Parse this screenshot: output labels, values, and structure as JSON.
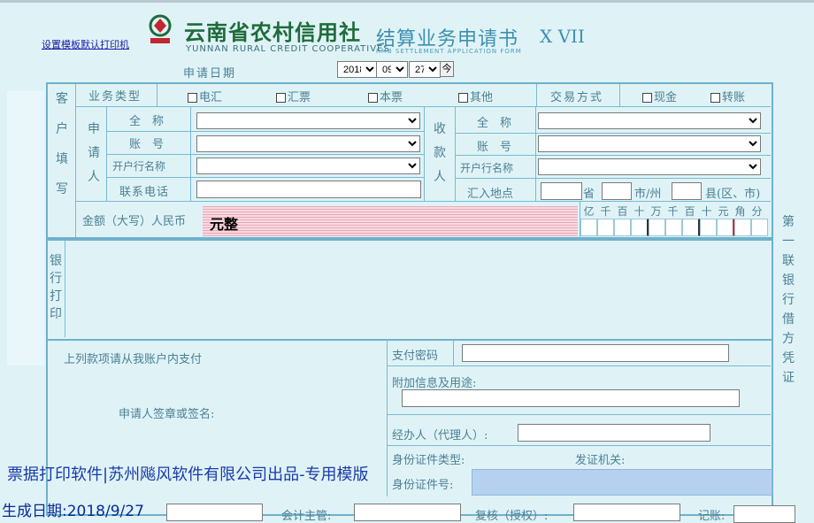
{
  "header": {
    "template_link": "设置模板默认打印机",
    "bank_name_cn": "云南省农村信用社",
    "bank_name_en": "YUNNAN RURAL CREDIT COOPERATIVES",
    "form_title": "结算业务申请书",
    "form_title_en": "RMB SETTLEMENT APPLICATION FORM",
    "form_code": "X VII",
    "apply_date_label": "申请日期",
    "date": {
      "year": "2018",
      "month": "09",
      "day": "27",
      "today_btn": "今"
    }
  },
  "section_labels": {
    "customer_fill": [
      "客",
      "户",
      "填",
      "写"
    ],
    "bank_print": [
      "银",
      "行",
      "打",
      "印"
    ],
    "applicant": [
      "申",
      "请",
      "人"
    ],
    "payee": [
      "收",
      "款",
      "人"
    ]
  },
  "business": {
    "type_label": "业务类型",
    "options": [
      "电汇",
      "汇票",
      "本票",
      "其他"
    ],
    "method_label": "交易方式",
    "methods": [
      "现金",
      "转账"
    ]
  },
  "fields": {
    "name": "全　称",
    "account": "账　号",
    "bank": "开户行名称",
    "phone": "联系电话",
    "remit_place": "汇入地点",
    "province": "省",
    "city": "市/州",
    "county": "县(区、市)"
  },
  "amount": {
    "label": "金额（大写）人民币",
    "value": "元整",
    "digits": [
      "亿",
      "千",
      "百",
      "十",
      "万",
      "千",
      "百",
      "十",
      "元",
      "角",
      "分"
    ]
  },
  "lower": {
    "pay_statement": "上列款项请从我账户内支付",
    "signature": "申请人签章或签名:",
    "pay_password": "支付密码",
    "additional_info": "附加信息及用途:",
    "agent": "经办人（代理人）:",
    "id_type": "身份证件类型:",
    "issuer": "发证机关:",
    "id_number": "身份证件号:"
  },
  "bottom_row": {
    "accountant": "会计主管:",
    "review": "复核（授权）:",
    "bookkeeping": "记账:"
  },
  "side_text": [
    "第",
    "一",
    "联",
    "",
    "银",
    "行",
    "借",
    "方",
    "凭",
    "证"
  ],
  "footer": {
    "software": "票据打印软件|苏州飚风软件有限公司出品-专用模版",
    "generated": "生成日期:2018/9/27"
  }
}
